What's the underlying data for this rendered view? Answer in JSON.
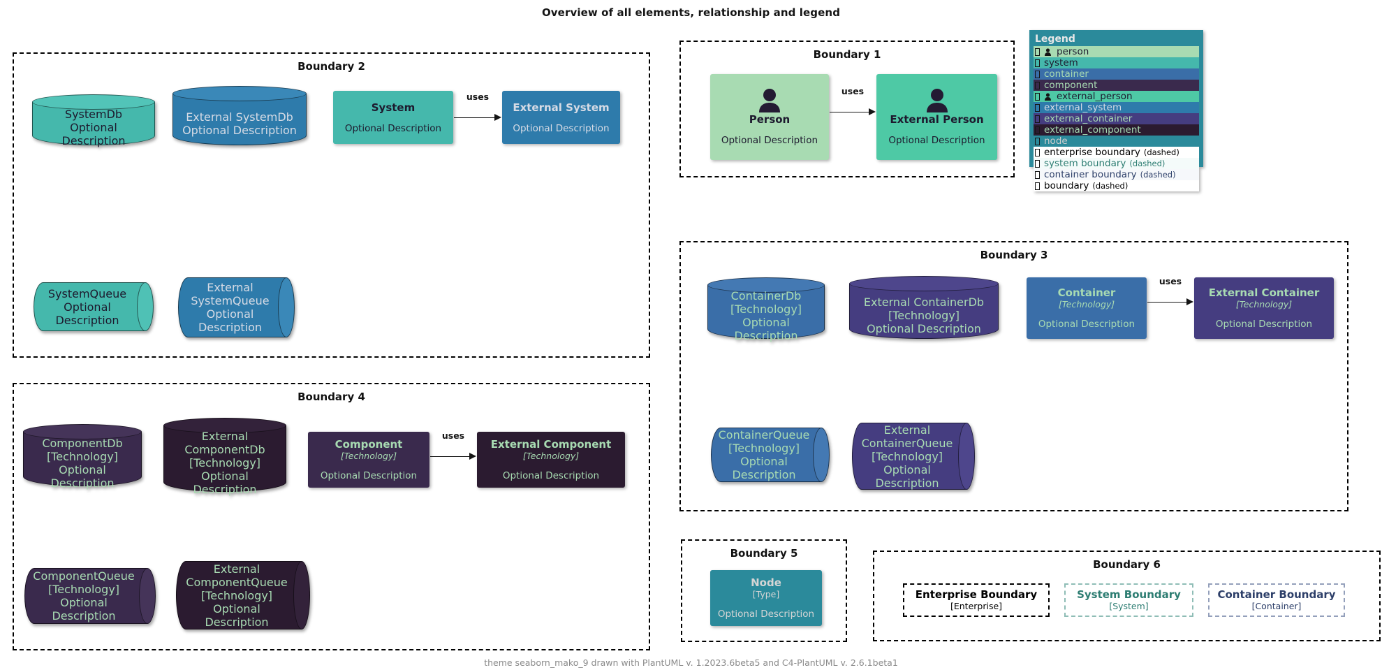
{
  "title": "Overview of all elements, relationship and legend",
  "footer": "theme seaborn_mako_9 drawn with PlantUML v. 1.2023.6beta5 and C4-PlantUML v. 2.6.1beta1",
  "labels": {
    "optional_description": "Optional Description",
    "technology": "[Technology]",
    "type": "[Type]",
    "uses": "uses"
  },
  "colors": {
    "person": "#a8dbb2",
    "system": "#45b8ac",
    "container": "#3a6ea8",
    "component": "#3a2a4d",
    "external_person": "#4ec9a5",
    "external_system": "#2e7bab",
    "external_container": "#453d80",
    "external_component": "#2b1b30",
    "node": "#2b8a9b",
    "legend_bg": "#2b8a9b",
    "dark_text": "#1d1a2e",
    "light_text": "#e9e9ee",
    "green_text": "#a8dbb2",
    "system_boundary": "#2d7d72",
    "container_boundary": "#2d3f69",
    "enterprise_boundary": "#000000"
  },
  "boundaries": [
    {
      "name": "boundary2",
      "label": "Boundary 2"
    },
    {
      "name": "boundary1",
      "label": "Boundary 1"
    },
    {
      "name": "boundary3",
      "label": "Boundary 3"
    },
    {
      "name": "boundary4",
      "label": "Boundary 4"
    },
    {
      "name": "boundary5",
      "label": "Boundary 5"
    },
    {
      "name": "boundary6",
      "label": "Boundary 6"
    }
  ],
  "elements": {
    "system_db": {
      "title": "SystemDb",
      "desc": "Optional Description"
    },
    "external_system_db": {
      "title": "External SystemDb",
      "desc": "Optional Description"
    },
    "system": {
      "title": "System",
      "desc": "Optional Description"
    },
    "external_system": {
      "title": "External System",
      "desc": "Optional Description"
    },
    "system_queue": {
      "title": "SystemQueue",
      "desc": "Optional Description"
    },
    "external_system_queue": {
      "title": "External SystemQueue",
      "desc": "Optional Description"
    },
    "person": {
      "title": "Person",
      "desc": "Optional Description"
    },
    "external_person": {
      "title": "External Person",
      "desc": "Optional Description"
    },
    "container_db": {
      "title": "ContainerDb",
      "tech": "[Technology]",
      "desc": "Optional Description"
    },
    "external_container_db": {
      "title": "External ContainerDb",
      "tech": "[Technology]",
      "desc": "Optional Description"
    },
    "container": {
      "title": "Container",
      "tech": "[Technology]",
      "desc": "Optional Description"
    },
    "external_container": {
      "title": "External Container",
      "tech": "[Technology]",
      "desc": "Optional Description"
    },
    "container_queue": {
      "title": "ContainerQueue",
      "tech": "[Technology]",
      "desc": "Optional Description"
    },
    "external_container_queue": {
      "title": "External ContainerQueue",
      "tech": "[Technology]",
      "desc": "Optional Description"
    },
    "component_db": {
      "title": "ComponentDb",
      "tech": "[Technology]",
      "desc": "Optional Description"
    },
    "external_component_db": {
      "title": "External ComponentDb",
      "tech": "[Technology]",
      "desc": "Optional Description"
    },
    "component": {
      "title": "Component",
      "tech": "[Technology]",
      "desc": "Optional Description"
    },
    "external_component": {
      "title": "External Component",
      "tech": "[Technology]",
      "desc": "Optional Description"
    },
    "component_queue": {
      "title": "ComponentQueue",
      "tech": "[Technology]",
      "desc": "Optional Description"
    },
    "external_component_queue": {
      "title": "External ComponentQueue",
      "tech": "[Technology]",
      "desc": "Optional Description"
    },
    "node": {
      "title": "Node",
      "tech": "[Type]",
      "desc": "Optional Description"
    },
    "enterprise_boundary": {
      "title": "Enterprise Boundary",
      "tech": "[Enterprise]"
    },
    "system_boundary": {
      "title": "System Boundary",
      "tech": "[System]"
    },
    "container_boundary": {
      "title": "Container Boundary",
      "tech": "[Container]"
    }
  },
  "relationships": [
    {
      "name": "system-uses-external-system",
      "label": "uses"
    },
    {
      "name": "person-uses-external-person",
      "label": "uses"
    },
    {
      "name": "container-uses-external-container",
      "label": "uses"
    },
    {
      "name": "component-uses-external-component",
      "label": "uses"
    }
  ],
  "legend": {
    "title": "Legend",
    "items": [
      {
        "label": "person",
        "note": "",
        "swatch": "#a8dbb2",
        "row_bg": "#a8dbb2",
        "text": "#1d1a2e",
        "person_icon": true
      },
      {
        "label": "system",
        "note": "",
        "swatch": "#45b8ac",
        "row_bg": "#45b8ac",
        "text": "#1d1a2e",
        "person_icon": false
      },
      {
        "label": "container",
        "note": "",
        "swatch": "#3a6ea8",
        "row_bg": "#3a6ea8",
        "text": "#a8dbb2",
        "person_icon": false
      },
      {
        "label": "component",
        "note": "",
        "swatch": "#3a2a4d",
        "row_bg": "#3a2a4d",
        "text": "#a8dbb2",
        "person_icon": false
      },
      {
        "label": "external_person",
        "note": "",
        "swatch": "#4ec9a5",
        "row_bg": "#4ec9a5",
        "text": "#1d1a2e",
        "person_icon": true
      },
      {
        "label": "external_system",
        "note": "",
        "swatch": "#2e7bab",
        "row_bg": "#2e7bab",
        "text": "#d6dbe5",
        "person_icon": false
      },
      {
        "label": "external_container",
        "note": "",
        "swatch": "#453d80",
        "row_bg": "#453d80",
        "text": "#a8dbb2",
        "person_icon": false
      },
      {
        "label": "external_component",
        "note": "",
        "swatch": "#2b1b30",
        "row_bg": "#2b1b30",
        "text": "#a8dbb2",
        "person_icon": false
      },
      {
        "label": "node",
        "note": "",
        "swatch": "#2b8a9b",
        "row_bg": "#2b8a9b",
        "text": "#cfcfcf",
        "person_icon": false
      },
      {
        "label": "enterprise boundary",
        "note": "(dashed)",
        "swatch": "#ffffff",
        "row_bg": "#ffffff",
        "text": "#000000",
        "person_icon": false
      },
      {
        "label": "system boundary",
        "note": "(dashed)",
        "swatch": "#ffffff",
        "row_bg": "#f4fbfa",
        "text": "#2d7d72",
        "person_icon": false
      },
      {
        "label": "container boundary",
        "note": "(dashed)",
        "swatch": "#ffffff",
        "row_bg": "#f6f8fb",
        "text": "#2d3f69",
        "person_icon": false
      },
      {
        "label": "boundary",
        "note": "(dashed)",
        "swatch": "#ffffff",
        "row_bg": "#ffffff",
        "text": "#000000",
        "person_icon": false
      }
    ]
  }
}
